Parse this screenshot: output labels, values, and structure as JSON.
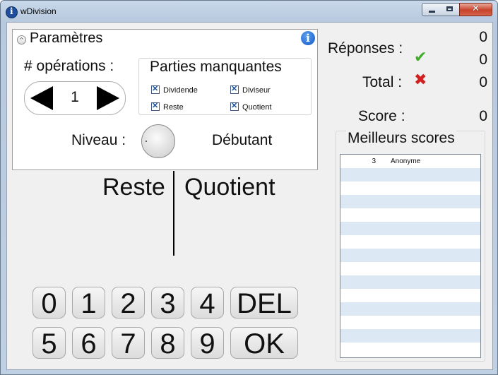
{
  "window": {
    "title": "wDivision"
  },
  "params": {
    "title": "Paramètres",
    "ops_label": "# opérations :",
    "ops_value": "1",
    "missing_title": "Parties manquantes",
    "checkboxes": [
      {
        "label": "Dividende",
        "checked": true
      },
      {
        "label": "Diviseur",
        "checked": true
      },
      {
        "label": "Reste",
        "checked": true
      },
      {
        "label": "Quotient",
        "checked": true
      }
    ],
    "niveau_label": "Niveau :",
    "niveau_value": "Débutant"
  },
  "division": {
    "reste": "Reste",
    "quotient": "Quotient"
  },
  "keypad": {
    "row1": [
      "0",
      "1",
      "2",
      "3",
      "4",
      "DEL"
    ],
    "row2": [
      "5",
      "6",
      "7",
      "8",
      "9",
      "OK"
    ]
  },
  "stats": {
    "reponses_label": "Réponses :",
    "correct": "0",
    "wrong": "0",
    "total_label": "Total :",
    "total": "0",
    "score_label": "Score :",
    "score": "0"
  },
  "scores": {
    "title": "Meilleurs scores",
    "rows": [
      {
        "score": "3",
        "name": "Anonyme"
      }
    ]
  },
  "colors": {
    "correct": "#3fae2a",
    "wrong": "#d21f1f",
    "row_stripe": "#dde8f5"
  }
}
